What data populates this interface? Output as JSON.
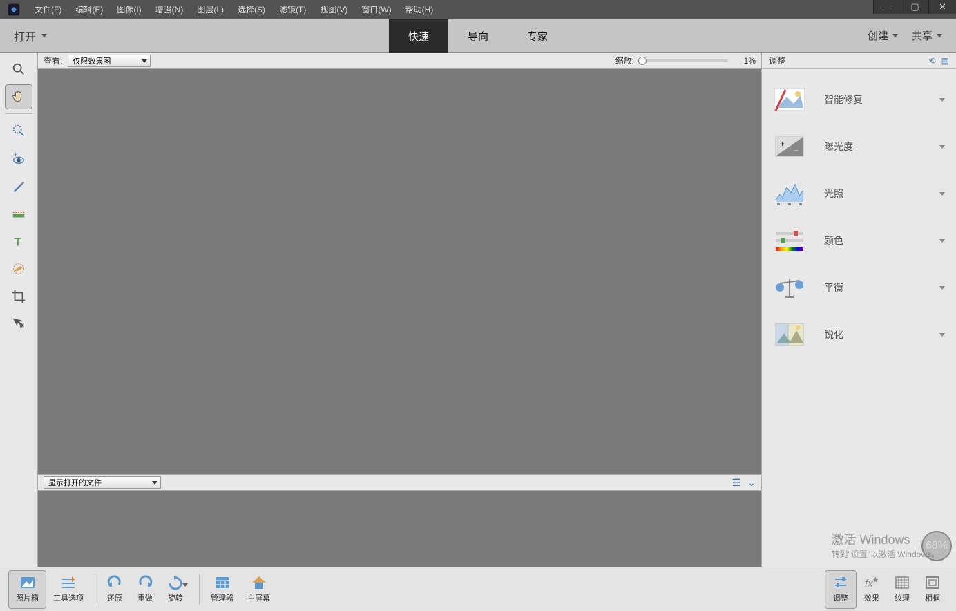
{
  "menubar": [
    "文件(F)",
    "编辑(E)",
    "图像(I)",
    "增强(N)",
    "图层(L)",
    "选择(S)",
    "滤镜(T)",
    "视图(V)",
    "窗口(W)",
    "帮助(H)"
  ],
  "actionbar": {
    "open": "打开",
    "tabs": [
      "快速",
      "导向",
      "专家"
    ],
    "active_tab": "快速",
    "create": "创建",
    "share": "共享"
  },
  "optbar": {
    "view_label": "查看:",
    "view_value": "仅限效果图",
    "zoom_label": "缩放:",
    "zoom_value": "1%"
  },
  "filebar": {
    "dropdown": "显示打开的文件"
  },
  "rpanel": {
    "title": "调整",
    "items": [
      "智能修复",
      "曝光度",
      "光照",
      "颜色",
      "平衡",
      "锐化"
    ]
  },
  "bottombar": {
    "left": [
      "照片箱",
      "工具选项",
      "还原",
      "重做",
      "旋转",
      "管理器",
      "主屏幕"
    ],
    "right": [
      "调整",
      "效果",
      "纹理",
      "相框"
    ]
  },
  "watermark": {
    "l1": "激活 Windows",
    "l2": "转到\"设置\"以激活 Windows。"
  },
  "badge": "68%",
  "tools": [
    "zoom",
    "hand",
    "quick-select",
    "eye",
    "brush",
    "crop-horizon",
    "text",
    "patch",
    "crop",
    "move"
  ]
}
